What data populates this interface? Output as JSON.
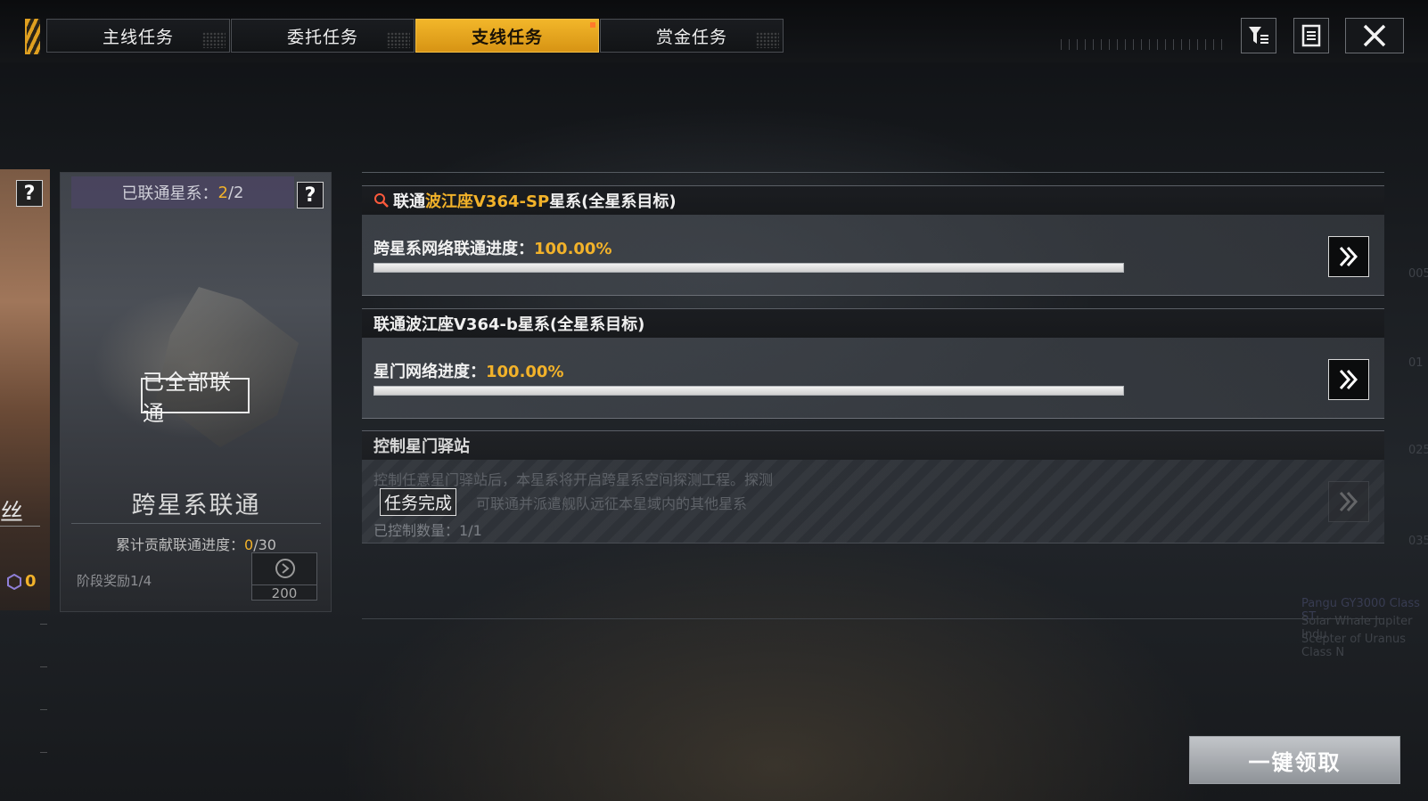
{
  "tabs": [
    {
      "label": "主线任务"
    },
    {
      "label": "委托任务"
    },
    {
      "label": "支线任务"
    },
    {
      "label": "赏金任务"
    }
  ],
  "left_strip": {
    "partial_char": "丝",
    "currency_value": "0"
  },
  "card": {
    "linked_prefix": "已联通星系：",
    "linked_current": "2",
    "linked_total": "/2",
    "stamp": "已全部联通",
    "title": "跨星系联通",
    "progress_prefix": "累计贡献联通进度：",
    "progress_current": "0",
    "progress_total": "/30",
    "stage_label": "阶段奖励1/4",
    "reward_value": "200"
  },
  "tasks": [
    {
      "title_prefix": "联通",
      "title_highlight": "波江座V364-SP",
      "title_suffix": "星系(全星系目标)",
      "progress_label": "跨星系网络联通进度：",
      "progress_value": "100.00%",
      "progress_fraction": 1.0
    },
    {
      "title": "联通波江座V364-b星系(全星系目标)",
      "progress_label": "星门网络进度：",
      "progress_value": "100.00%",
      "progress_fraction": 1.0
    },
    {
      "title": "控制星门驿站",
      "desc_line1": "控制任意星门驿站后，本星系将开启跨星系空间探测工程。探测",
      "desc_line2": "可联通并派遣舰队远征本星域内的其他星系",
      "stamp": "任务完成",
      "count_label": "已控制数量：1/1"
    }
  ],
  "side_text": {
    "line1": "Pangu GY3000 Class ST",
    "line2": "Solar Whale Jupiter Indu",
    "line3": "Scepter of Uranus Class N",
    "marks": [
      "005",
      "01",
      "025",
      "035"
    ]
  },
  "claim_button": "一键领取",
  "colors": {
    "accent": "#f2b22a",
    "tab_active": "#e3a11c"
  },
  "icons": [
    "filter-icon",
    "notes-icon",
    "close-icon",
    "help-icon",
    "chevron-double-right-icon",
    "badge-icon"
  ]
}
